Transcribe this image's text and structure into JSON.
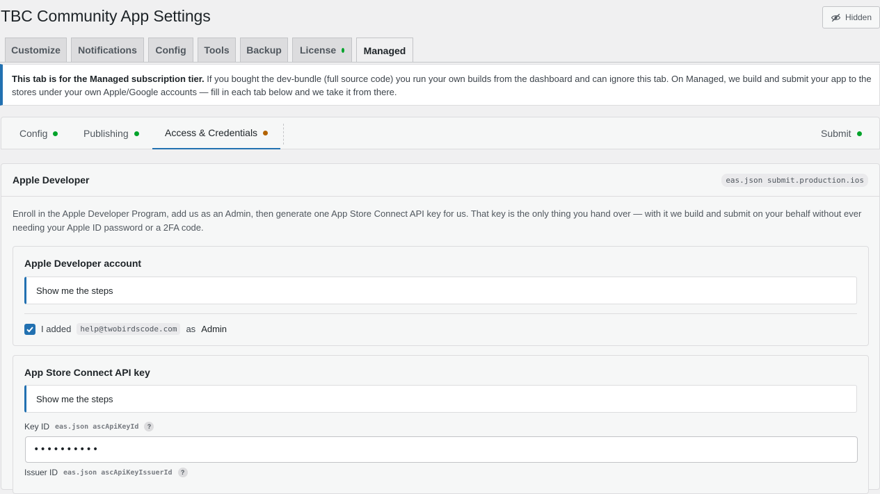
{
  "page": {
    "title": "TBC Community App Settings",
    "hidden_label": "Hidden"
  },
  "tabs": [
    {
      "label": "Customize"
    },
    {
      "label": "Notifications"
    },
    {
      "label": "Config"
    },
    {
      "label": "Tools"
    },
    {
      "label": "Backup"
    },
    {
      "label": "License"
    },
    {
      "label": "Managed"
    }
  ],
  "notice": {
    "strong": "This tab is for the Managed subscription tier.",
    "text": " If you bought the dev-bundle (full source code) you run your own builds from the dashboard and can ignore this tab. On Managed, we build and submit your app to the stores under your own Apple/Google accounts — fill in each tab below and we take it from there."
  },
  "subtabs": [
    {
      "label": "Config"
    },
    {
      "label": "Publishing"
    },
    {
      "label": "Access & Credentials"
    },
    {
      "label": "Submit"
    }
  ],
  "colors": {
    "accent": "#2271b1",
    "status_ok": "#00a32a",
    "status_warn": "#b26200"
  },
  "apple": {
    "title": "Apple Developer",
    "badge": "eas.json submit.production.ios",
    "description": "Enroll in the Apple Developer Program, add us as an Admin, then generate one App Store Connect API key for us. That key is the only thing you hand over — with it we build and submit on your behalf without ever needing your Apple ID password or a 2FA code.",
    "account": {
      "title": "Apple Developer account",
      "steps": "Show me the steps",
      "check_prefix": "I added",
      "check_email": "help@twobirdscode.com",
      "check_suffix": "as",
      "check_role": "Admin"
    },
    "asc": {
      "title": "App Store Connect API key",
      "steps": "Show me the steps",
      "key_id_label": "Key ID",
      "key_id_path": "eas.json ascApiKeyId",
      "key_id_value": "••••••••••",
      "issuer_label": "Issuer ID",
      "issuer_path": "eas.json ascApiKeyIssuerId",
      "help": "?"
    }
  }
}
